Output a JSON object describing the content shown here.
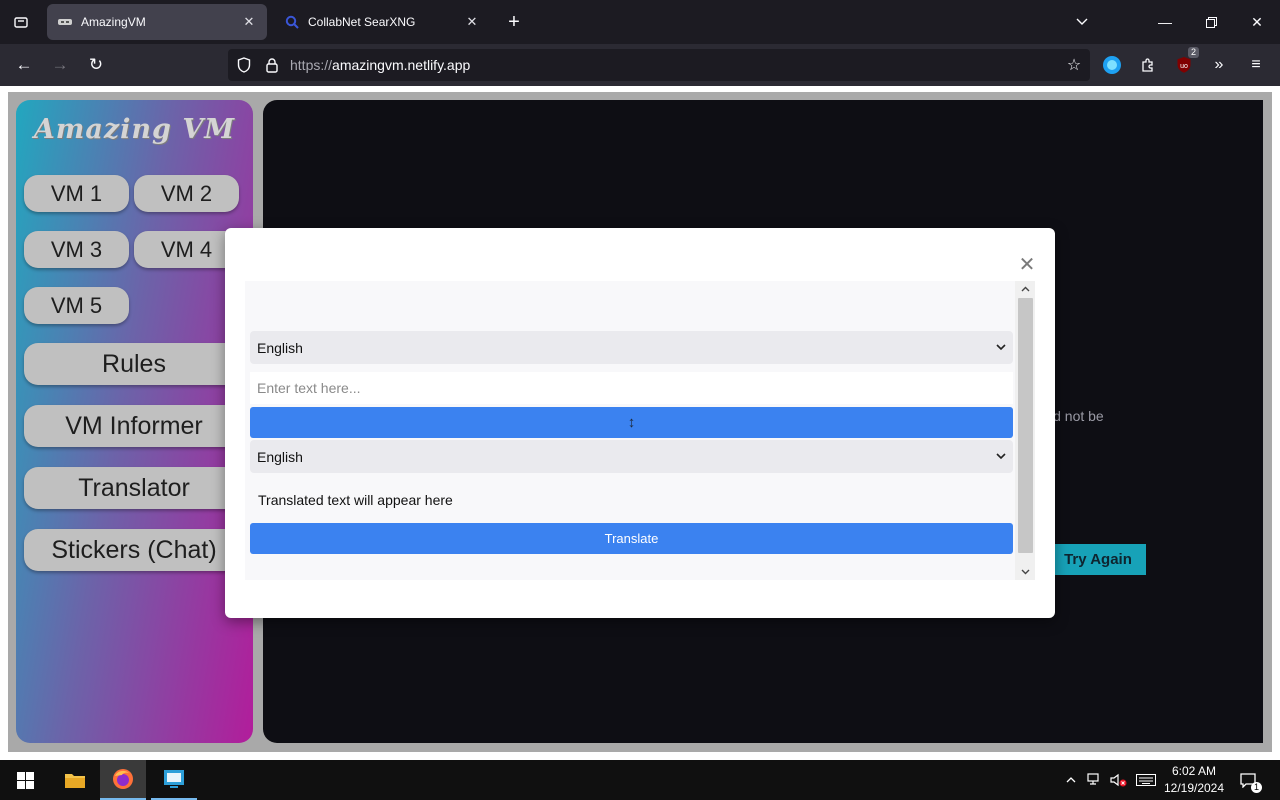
{
  "browser": {
    "tabs": [
      {
        "title": "AmazingVM",
        "active": true,
        "favicon": "amazingvm-favicon-icon"
      },
      {
        "title": "CollabNet SearXNG",
        "active": false,
        "favicon": "search-icon"
      }
    ],
    "url_prefix": "https://",
    "url_host": "amazingvm.netlify.app",
    "extensions_badge": "2"
  },
  "sidebar": {
    "logo": "Amazing VM",
    "vm_buttons": [
      "VM 1",
      "VM 2",
      "VM 3",
      "VM 4",
      "VM 5"
    ],
    "nav_buttons": [
      "Rules",
      "VM Informer",
      "Translator",
      "Stickers (Chat)"
    ]
  },
  "background": {
    "message_fragment": "ld not be",
    "try_again_label": "Try Again"
  },
  "translator": {
    "source_language": "English",
    "input_placeholder": "Enter text here...",
    "target_language": "English",
    "output_text": "Translated text will appear here",
    "translate_label": "Translate",
    "swap_symbol": "↕"
  },
  "taskbar": {
    "time": "6:02 AM",
    "date": "12/19/2024",
    "notifications": "1"
  },
  "colors": {
    "accent_blue": "#3b82f0",
    "try_again": "#17a2b8",
    "sidebar_gradient": [
      "#22a7bf",
      "#b21d9b"
    ]
  }
}
